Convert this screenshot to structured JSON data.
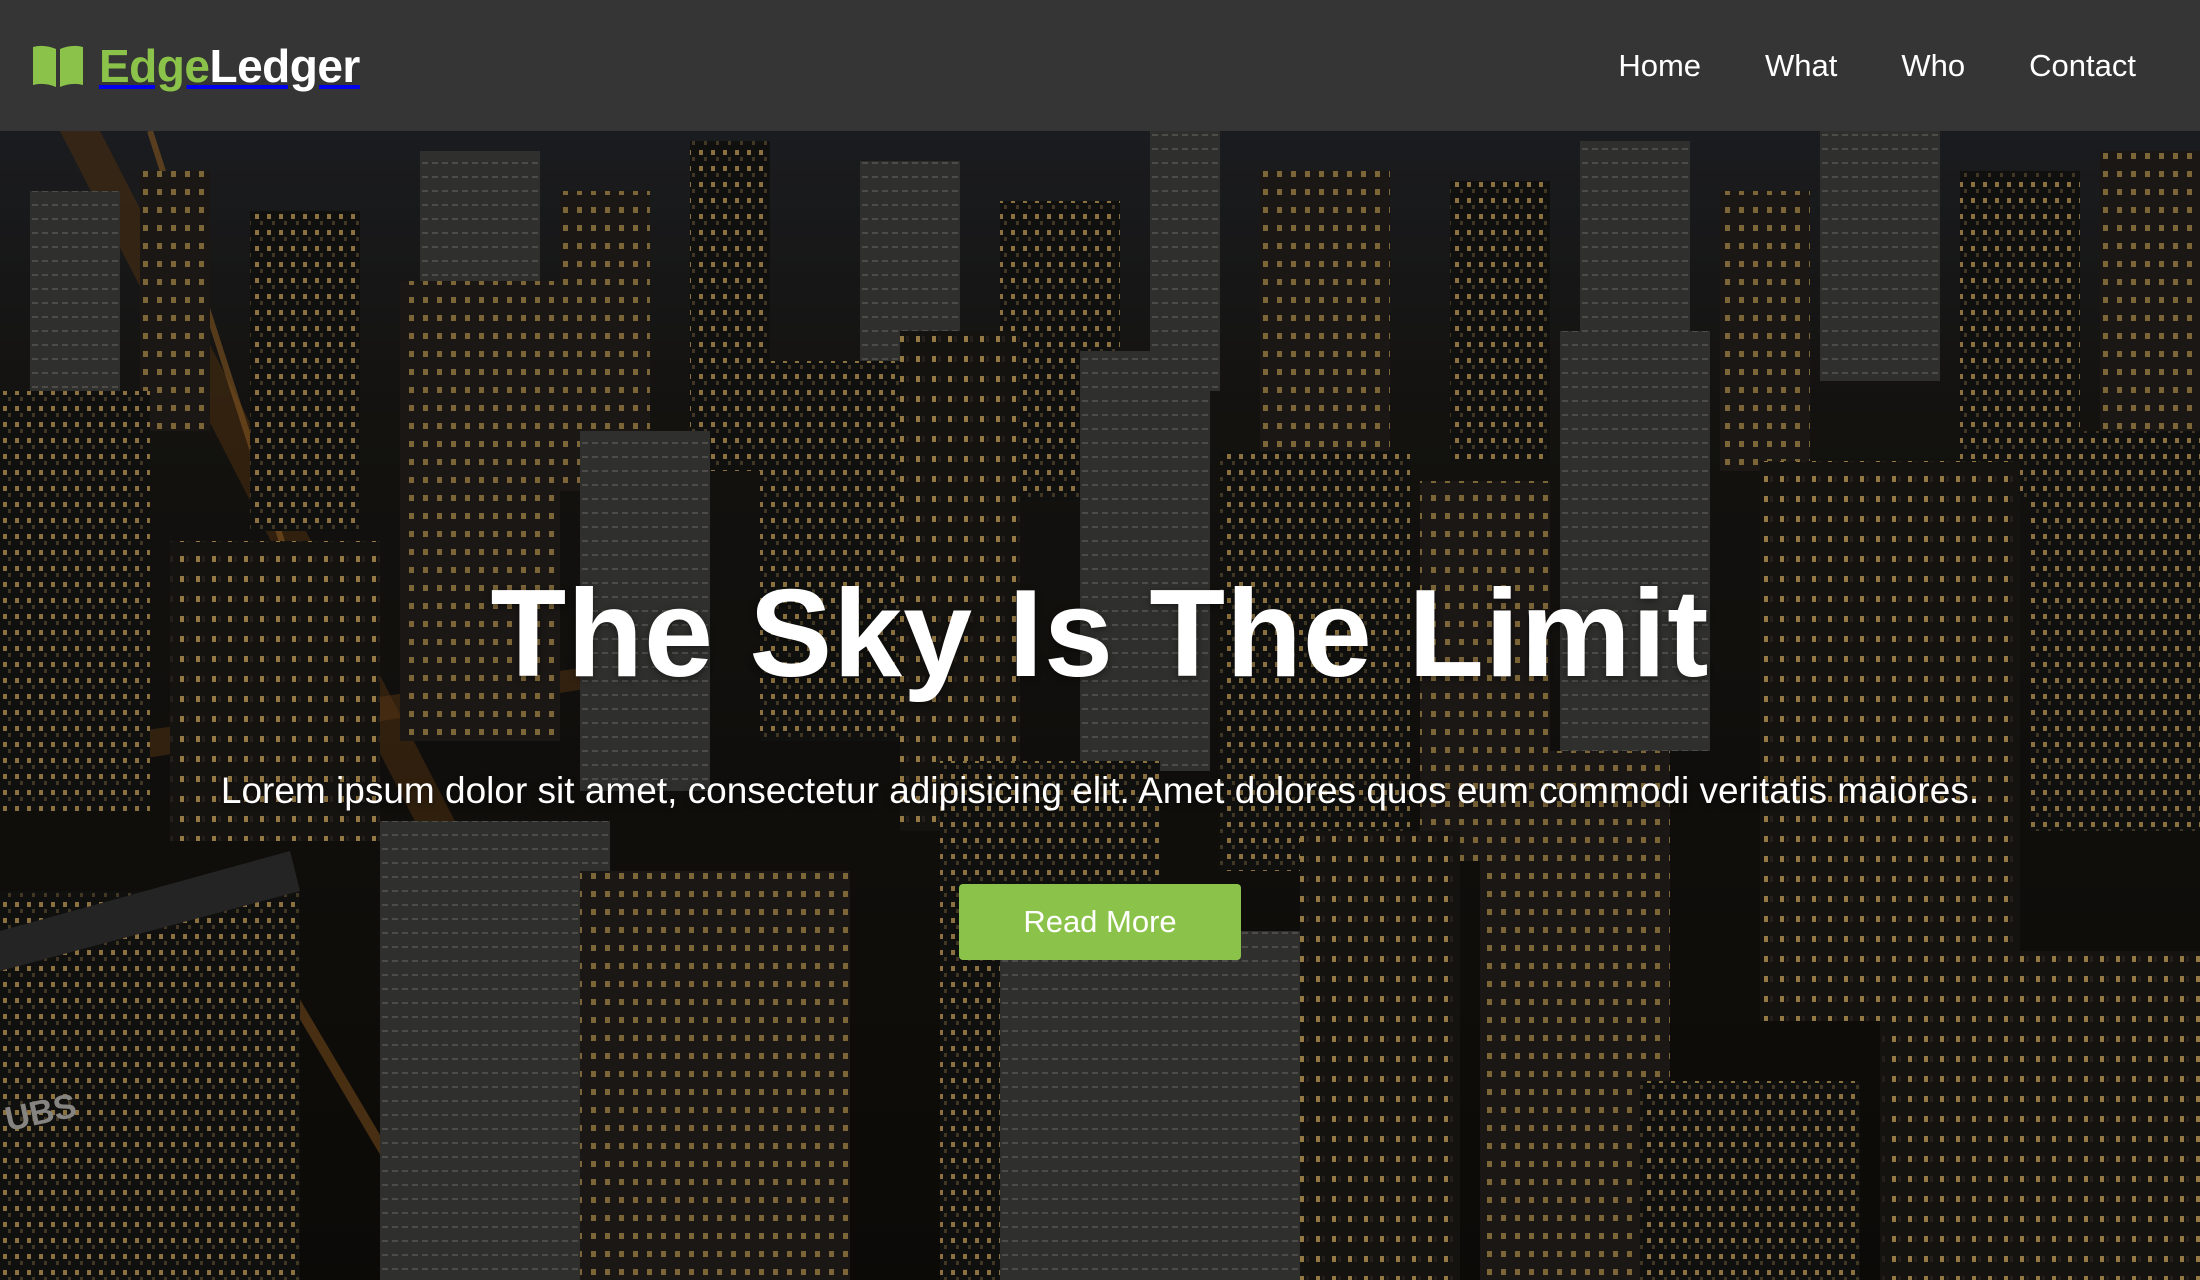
{
  "navbar": {
    "brand": {
      "part1": "Edge",
      "part2": "Ledger",
      "icon": "open-book-icon"
    },
    "links": [
      {
        "label": "Home"
      },
      {
        "label": "What"
      },
      {
        "label": "Who"
      },
      {
        "label": "Contact"
      }
    ]
  },
  "hero": {
    "title": "The Sky Is The Limit",
    "subtitle": "Lorem ipsum dolor sit amet, consectetur adipisicing elit. Amet dolores quos eum commodi veritatis maiores.",
    "button_label": "Read More",
    "background_sign": "UBS"
  },
  "colors": {
    "accent": "#8bc34a",
    "navbar_bg": "#353535",
    "text": "#ffffff"
  }
}
